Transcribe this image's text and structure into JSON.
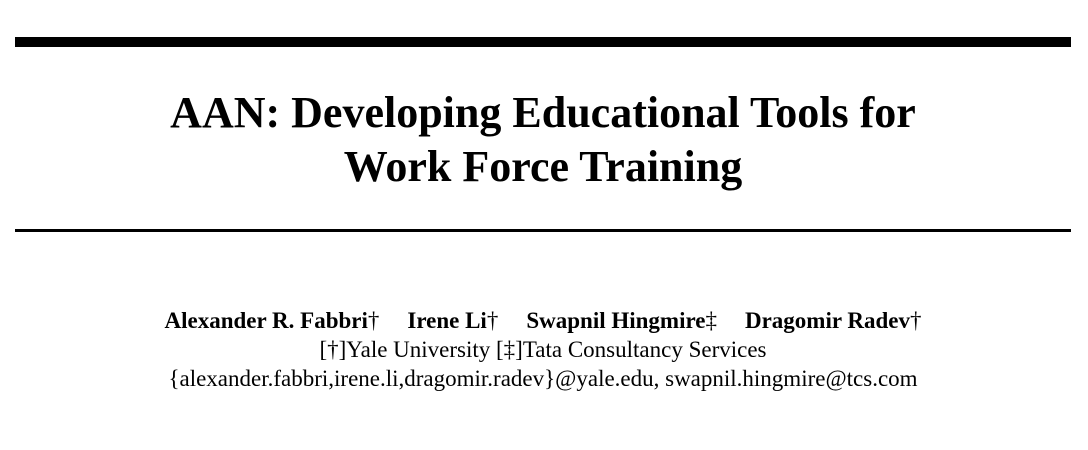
{
  "title": {
    "line1": "AAN: Developing Educational Tools for",
    "line2": "Work Force Training"
  },
  "authors": [
    {
      "name": "Alexander R. Fabbri",
      "mark": "†"
    },
    {
      "name": "Irene Li",
      "mark": "†"
    },
    {
      "name": "Swapnil Hingmire",
      "mark": "‡"
    },
    {
      "name": "Dragomir Radev",
      "mark": "†"
    }
  ],
  "affiliations": "[†]Yale University [‡]Tata Consultancy Services",
  "emails": "{alexander.fabbri,irene.li,dragomir.radev}@yale.edu, swapnil.hingmire@tcs.com"
}
